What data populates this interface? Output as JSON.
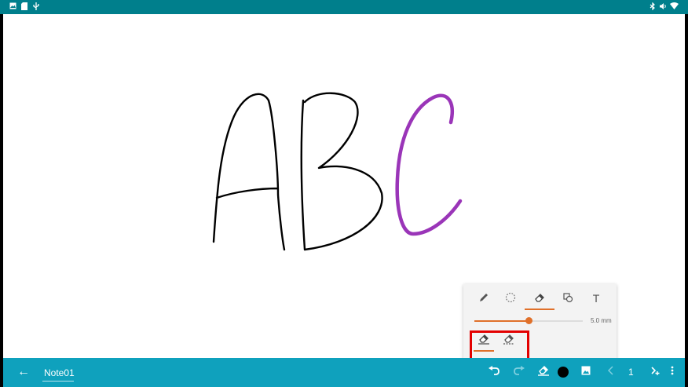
{
  "statusbar": {
    "left_icons": [
      "image-icon",
      "sd-card-icon",
      "usb-icon"
    ],
    "right_icons": [
      "bluetooth-icon",
      "volume-icon",
      "wifi-icon"
    ]
  },
  "canvas": {
    "strokes": [
      {
        "name": "letter-a",
        "color": "#000000"
      },
      {
        "name": "letter-b",
        "color": "#000000"
      },
      {
        "name": "letter-c",
        "color": "#9a35b8"
      }
    ]
  },
  "tool_panel": {
    "tools": [
      "pen-icon",
      "lasso-icon",
      "eraser-icon",
      "shape-icon",
      "text-icon"
    ],
    "selected_tool": "eraser-icon",
    "text_tool_glyph": "T",
    "eraser_size": 0.5,
    "eraser_size_label": "5.0 mm",
    "eraser_modes": [
      "stroke-eraser-icon",
      "area-eraser-icon"
    ],
    "selected_eraser_mode": "stroke-eraser-icon",
    "accent": "#e0702a"
  },
  "bottombar": {
    "back_glyph": "←",
    "note_title": "Note01",
    "page_number": "1",
    "pen_color": "#000000",
    "bar_color": "#0fa1bd"
  }
}
